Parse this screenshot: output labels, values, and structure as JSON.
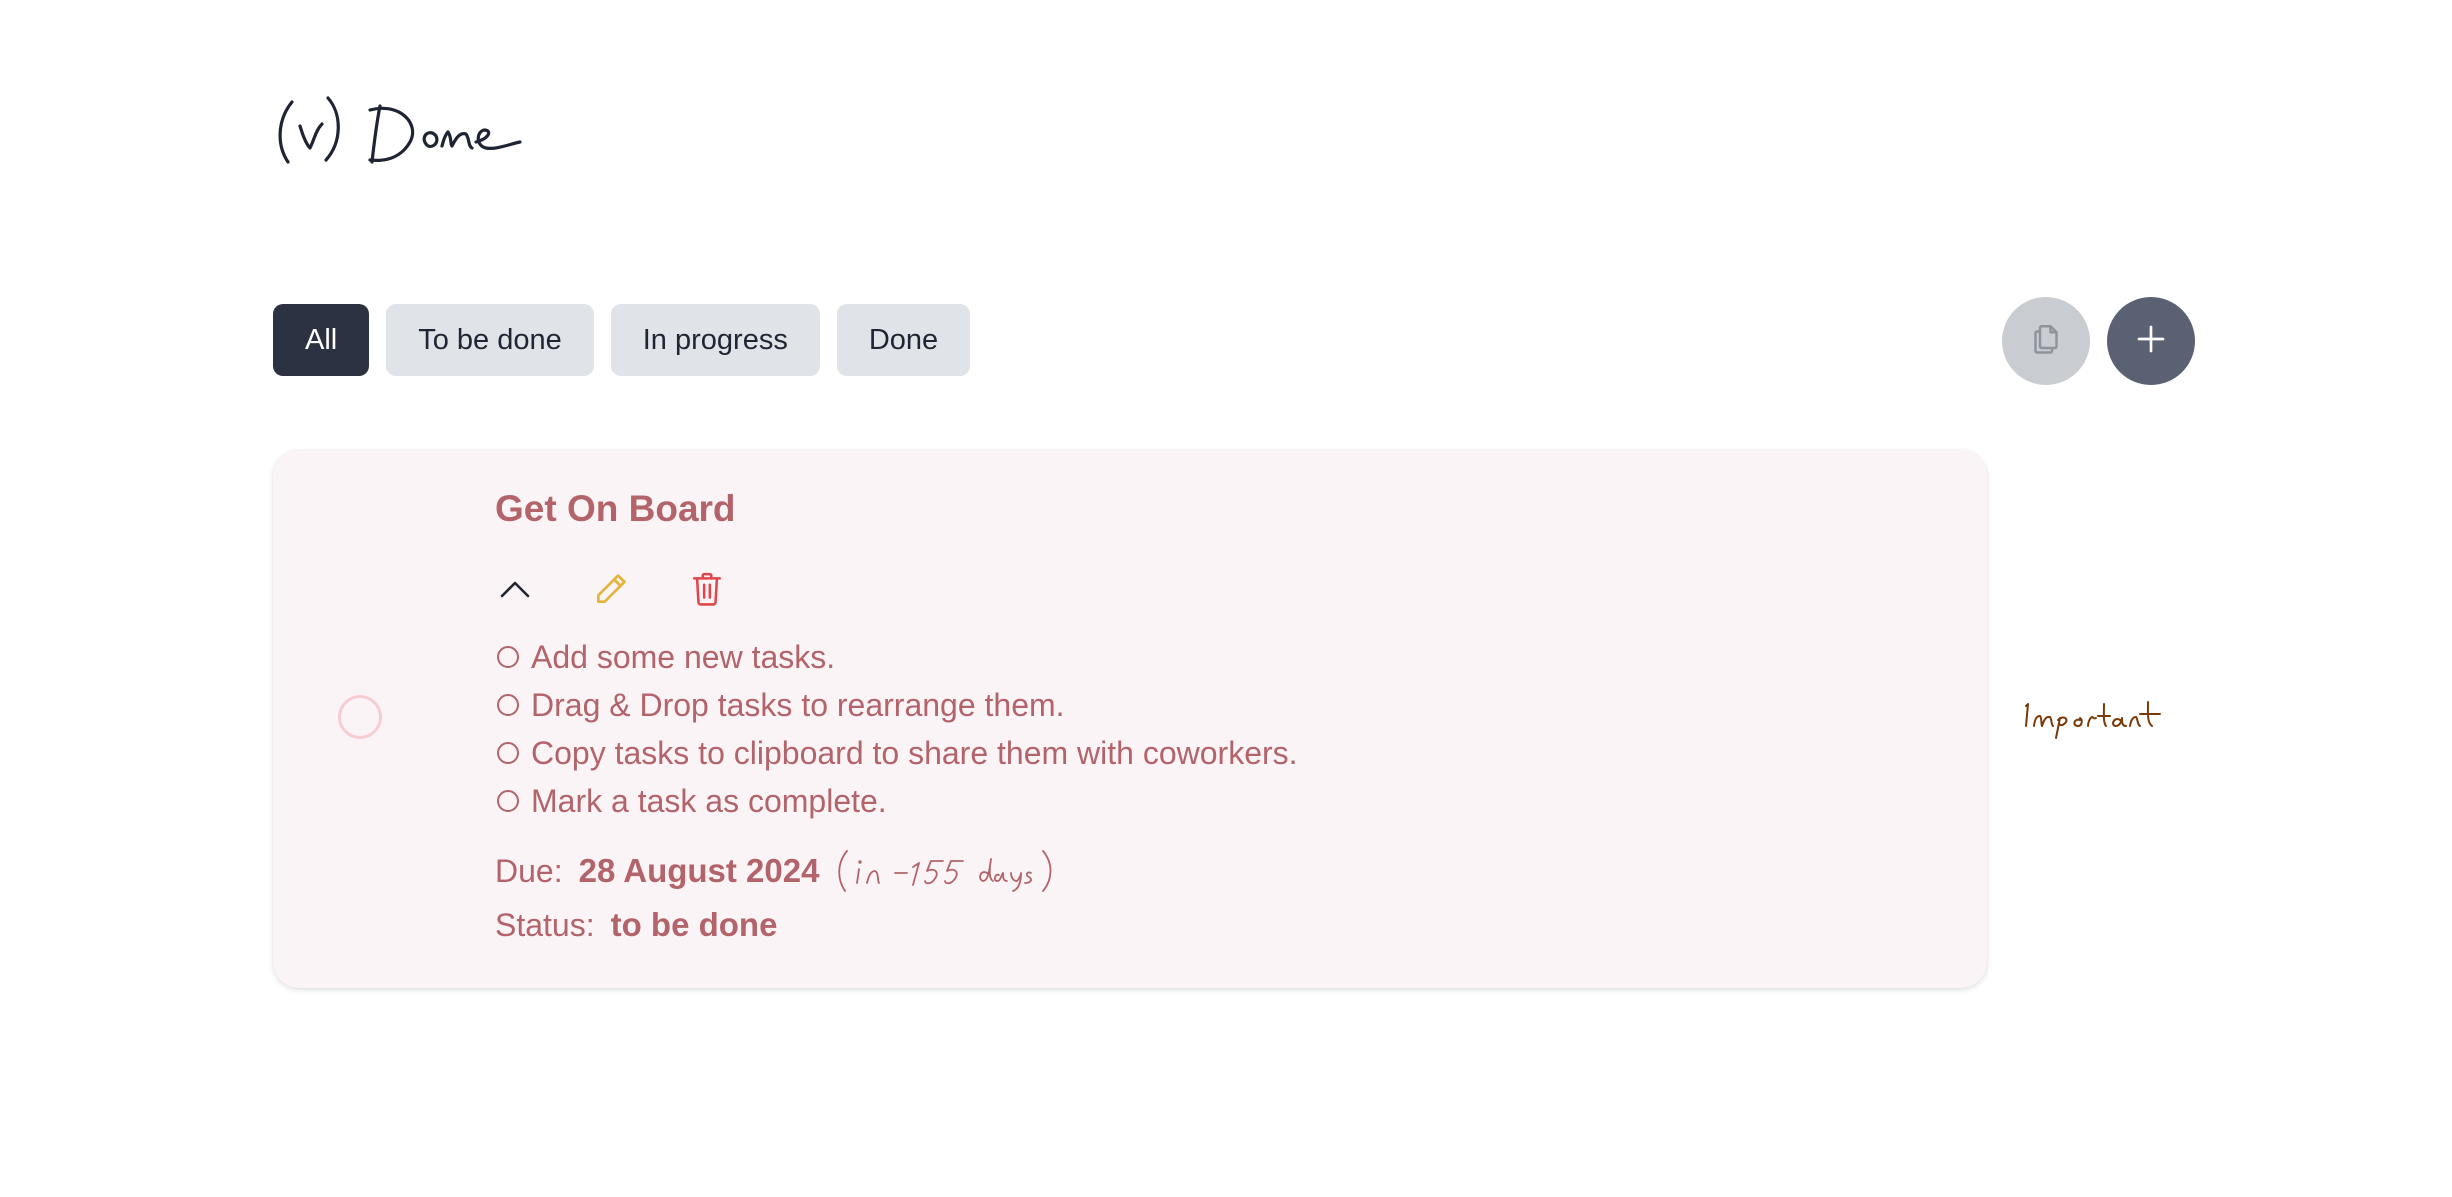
{
  "app": {
    "logo_text": "(v) Done"
  },
  "filters": [
    {
      "label": "All",
      "active": true
    },
    {
      "label": "To be done",
      "active": false
    },
    {
      "label": "In progress",
      "active": false
    },
    {
      "label": "Done",
      "active": false
    }
  ],
  "toolbar": {
    "copy_icon": "copy-icon",
    "add_icon": "plus-icon"
  },
  "task": {
    "title": "Get On Board",
    "steps": [
      "Add some new tasks.",
      "Drag & Drop tasks to rearrange them.",
      "Copy tasks to clipboard to share them with coworkers.",
      "Mark a task as complete."
    ],
    "due_label": "Due:",
    "due_date": "28 August 2024",
    "due_relative": "(in -155 days)",
    "status_label": "Status:",
    "status_value": "to be done",
    "priority_label": "Important",
    "colors": {
      "text": "#b3636a",
      "card_bg": "#fbf4f6",
      "edit_icon": "#e3b33a",
      "delete_icon": "#e0464b",
      "priority": "#7a3a08"
    }
  }
}
